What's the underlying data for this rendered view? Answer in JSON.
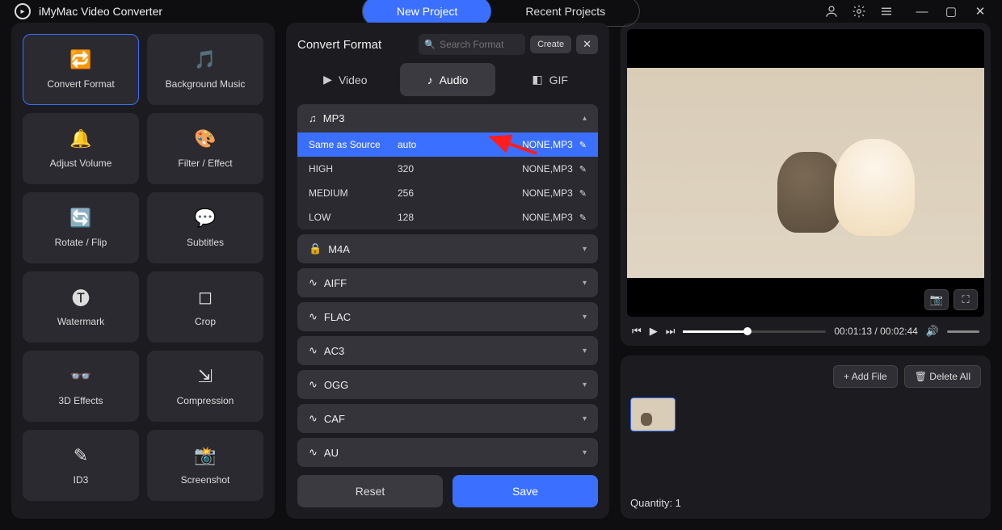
{
  "app": {
    "title": "iMyMac Video Converter"
  },
  "nav": {
    "new_project": "New Project",
    "recent_projects": "Recent Projects"
  },
  "sidebar": {
    "items": [
      {
        "label": "Convert Format",
        "icon": "convert-icon",
        "active": true
      },
      {
        "label": "Background Music",
        "icon": "music-icon"
      },
      {
        "label": "Adjust Volume",
        "icon": "volume-icon"
      },
      {
        "label": "Filter / Effect",
        "icon": "filter-icon"
      },
      {
        "label": "Rotate / Flip",
        "icon": "rotate-icon"
      },
      {
        "label": "Subtitles",
        "icon": "subtitles-icon"
      },
      {
        "label": "Watermark",
        "icon": "watermark-icon"
      },
      {
        "label": "Crop",
        "icon": "crop-icon"
      },
      {
        "label": "3D Effects",
        "icon": "3d-icon"
      },
      {
        "label": "Compression",
        "icon": "compress-icon"
      },
      {
        "label": "ID3",
        "icon": "id3-icon"
      },
      {
        "label": "Screenshot",
        "icon": "screenshot-icon"
      }
    ]
  },
  "center": {
    "title": "Convert Format",
    "search_placeholder": "Search Format",
    "create_label": "Create",
    "tabs": {
      "video": "Video",
      "audio": "Audio",
      "gif": "GIF"
    },
    "formats": [
      {
        "name": "MP3",
        "icon": "music-note-icon",
        "expanded": true,
        "presets": [
          {
            "name": "Same as Source",
            "bitrate": "auto",
            "tag": "NONE,MP3",
            "active": true
          },
          {
            "name": "HIGH",
            "bitrate": "320",
            "tag": "NONE,MP3"
          },
          {
            "name": "MEDIUM",
            "bitrate": "256",
            "tag": "NONE,MP3"
          },
          {
            "name": "LOW",
            "bitrate": "128",
            "tag": "NONE,MP3"
          }
        ]
      },
      {
        "name": "M4A",
        "icon": "lock-icon"
      },
      {
        "name": "AIFF",
        "icon": "wave-icon"
      },
      {
        "name": "FLAC",
        "icon": "wave-icon"
      },
      {
        "name": "AC3",
        "icon": "wave-icon"
      },
      {
        "name": "OGG",
        "icon": "wave-icon"
      },
      {
        "name": "CAF",
        "icon": "wave-icon"
      },
      {
        "name": "AU",
        "icon": "wave-icon"
      }
    ],
    "reset_label": "Reset",
    "save_label": "Save"
  },
  "player": {
    "current_time": "00:01:13",
    "total_time": "00:02:44",
    "progress_pct": 45
  },
  "queue": {
    "add_file_label": "+ Add File",
    "delete_all_label": "Delete All",
    "quantity_label": "Quantity:",
    "quantity_value": "1"
  }
}
